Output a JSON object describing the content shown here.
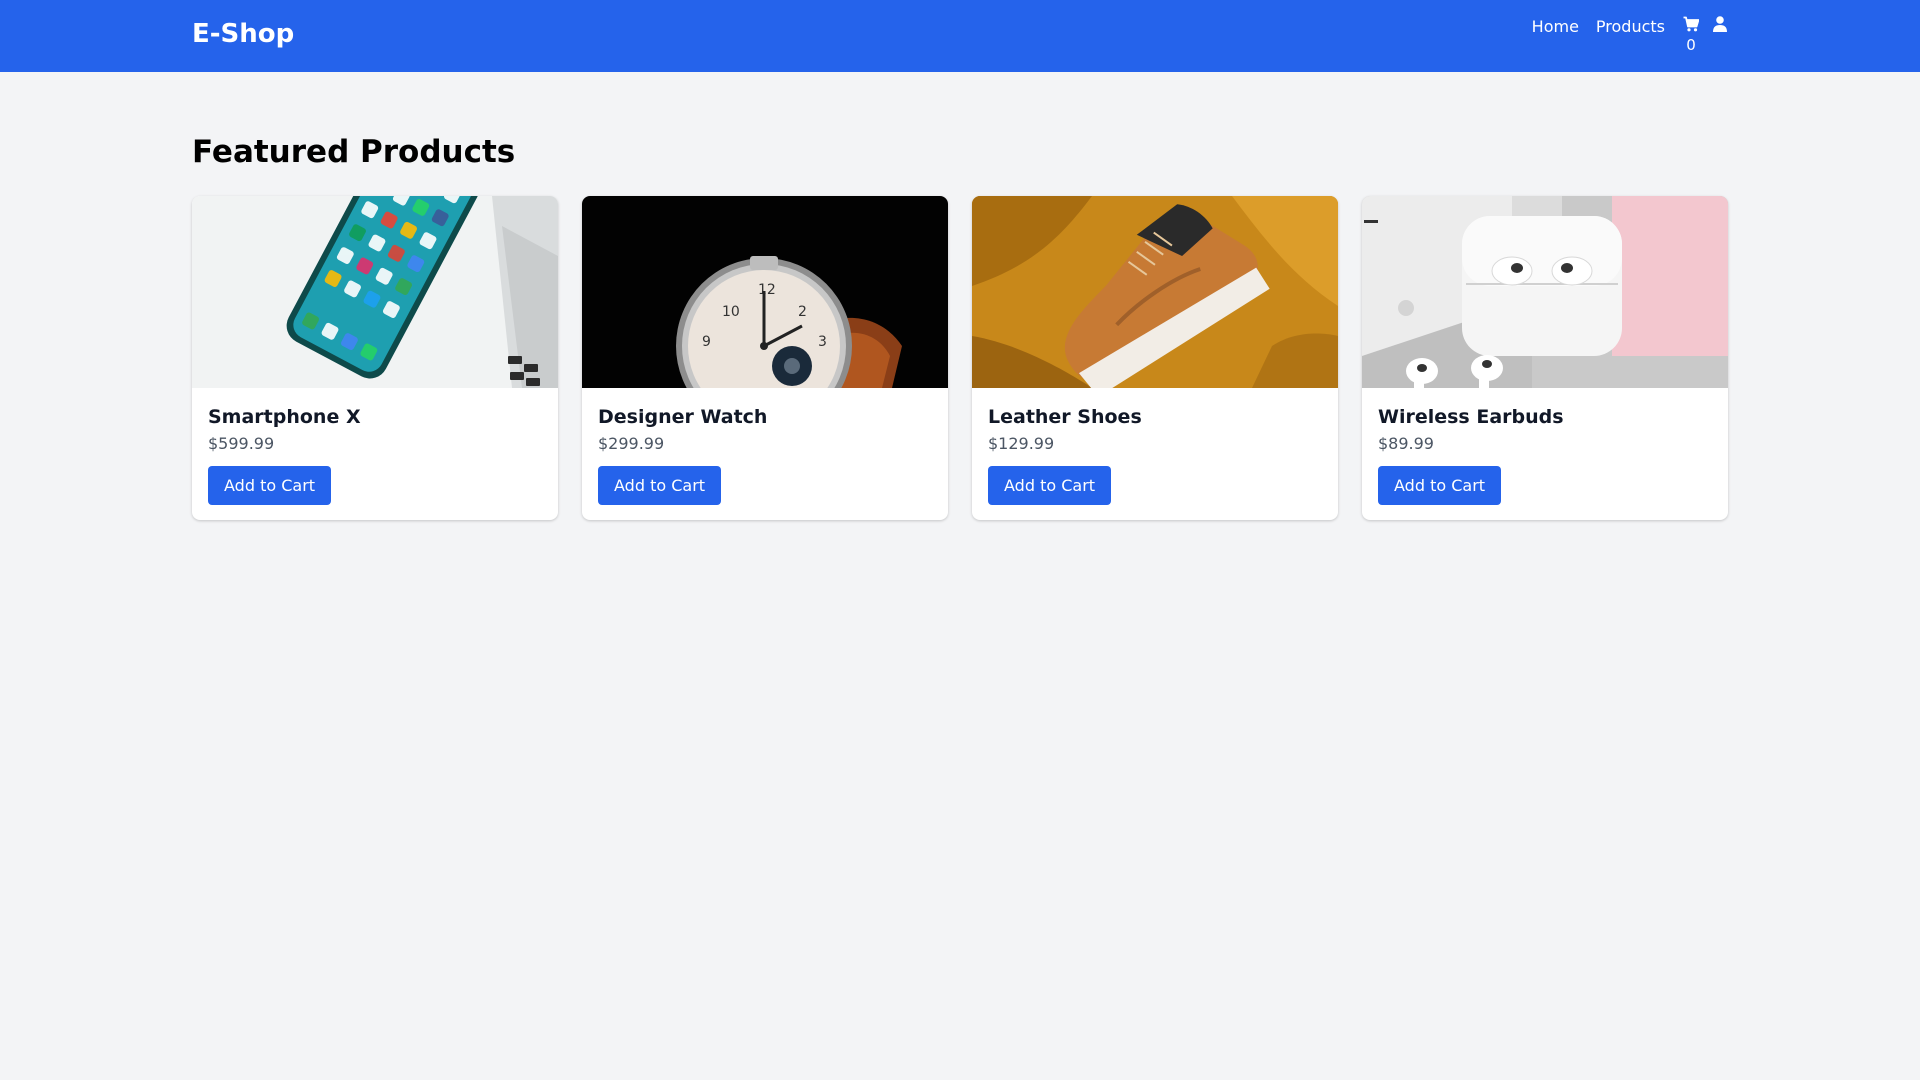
{
  "nav": {
    "brand": "E-Shop",
    "links": [
      "Home",
      "Products"
    ],
    "cart_count": "0",
    "cart_icon": "shopping-cart-icon",
    "user_icon": "user-icon",
    "bg_color": "#2563eb"
  },
  "main": {
    "section_title": "Featured Products",
    "products": [
      {
        "name": "Smartphone X",
        "price": "$599.99",
        "button": "Add to Cart",
        "image": "smartphone-image"
      },
      {
        "name": "Designer Watch",
        "price": "$299.99",
        "button": "Add to Cart",
        "image": "watch-image"
      },
      {
        "name": "Leather Shoes",
        "price": "$129.99",
        "button": "Add to Cart",
        "image": "shoes-image"
      },
      {
        "name": "Wireless Earbuds",
        "price": "$89.99",
        "button": "Add to Cart",
        "image": "earbuds-image"
      }
    ]
  },
  "colors": {
    "accent": "#2563eb",
    "page_bg": "#f3f4f6",
    "card_bg": "#ffffff",
    "price_text": "#4b5563"
  }
}
